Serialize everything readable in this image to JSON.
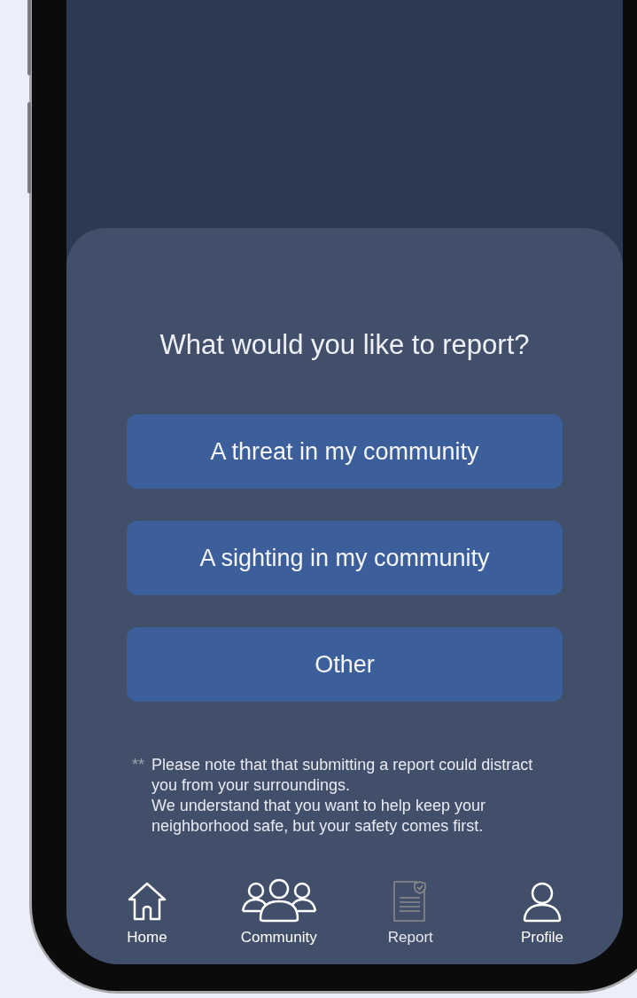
{
  "prompt": {
    "title": "What would you like to report?"
  },
  "options": [
    {
      "label": "A threat in my community"
    },
    {
      "label": "A sighting in my community"
    },
    {
      "label": "Other"
    }
  ],
  "note": {
    "marker": "**",
    "paragraphs": [
      "Please note that that submitting a report could distract you from your surroundings.",
      "We understand that you want to help keep your neighborhood safe, but your safety comes first."
    ]
  },
  "tab_bar": [
    {
      "kind": "home",
      "label": "Home",
      "selected": false
    },
    {
      "kind": "community",
      "label": "Community",
      "selected": false
    },
    {
      "kind": "report",
      "label": "Report",
      "selected": true
    },
    {
      "kind": "profile",
      "label": "Profile",
      "selected": false
    }
  ]
}
